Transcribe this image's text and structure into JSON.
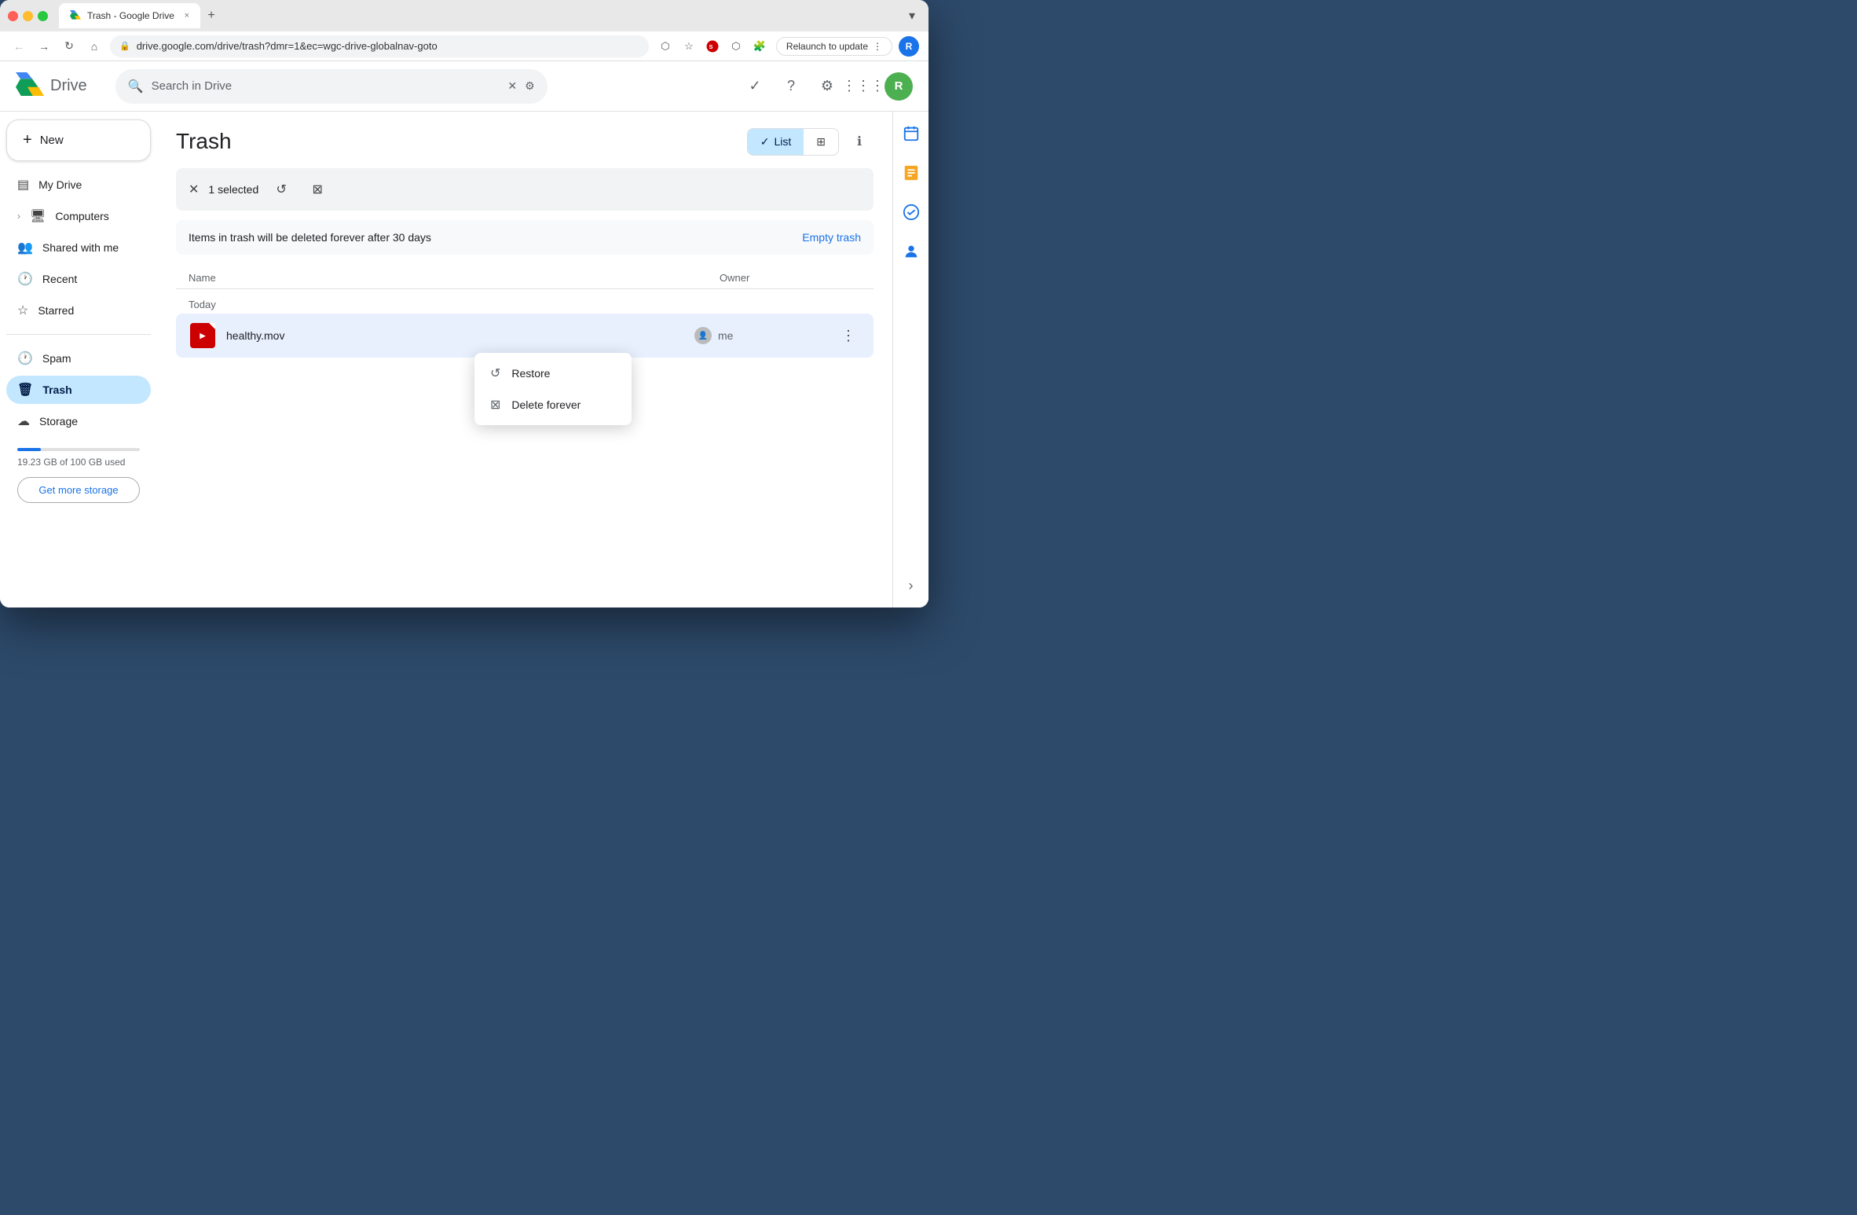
{
  "browser": {
    "tab_title": "Trash - Google Drive",
    "tab_close": "×",
    "new_tab": "+",
    "url": "drive.google.com/drive/trash?dmr=1&ec=wgc-drive-globalnav-goto",
    "nav_back_disabled": false,
    "nav_forward_disabled": false,
    "relaunch_label": "Relaunch to update",
    "overflow_icon": "▾",
    "profile_initial": "R"
  },
  "header": {
    "app_name": "Drive",
    "search_placeholder": "Search in Drive"
  },
  "sidebar": {
    "new_label": "New",
    "items": [
      {
        "id": "my-drive",
        "label": "My Drive",
        "icon": "▤"
      },
      {
        "id": "computers",
        "label": "Computers",
        "icon": "🖥"
      },
      {
        "id": "shared",
        "label": "Shared with me",
        "icon": "👥"
      },
      {
        "id": "recent",
        "label": "Recent",
        "icon": "🕐"
      },
      {
        "id": "starred",
        "label": "Starred",
        "icon": "☆"
      },
      {
        "id": "spam",
        "label": "Spam",
        "icon": "🕐"
      },
      {
        "id": "trash",
        "label": "Trash",
        "icon": "🗑",
        "active": true
      },
      {
        "id": "storage",
        "label": "Storage",
        "icon": "☁"
      }
    ],
    "storage_used": "19.23 GB of 100 GB used",
    "storage_percent": 19,
    "get_storage_label": "Get more storage"
  },
  "content": {
    "page_title": "Trash",
    "view_list_label": "List",
    "view_grid_label": "Grid",
    "selection_count": "1 selected",
    "banner_text": "Items in trash will be deleted forever after 30 days",
    "empty_trash_label": "Empty trash",
    "col_name": "Name",
    "col_owner": "Owner",
    "group_today": "Today",
    "file_name": "healthy.mov",
    "file_owner": "me"
  },
  "context_menu": {
    "items": [
      {
        "id": "restore",
        "label": "Restore",
        "icon": "↺"
      },
      {
        "id": "delete-forever",
        "label": "Delete forever",
        "icon": "⊠"
      }
    ]
  },
  "right_sidebar": {
    "icons": [
      "📅",
      "📝",
      "✓",
      "👤"
    ]
  }
}
